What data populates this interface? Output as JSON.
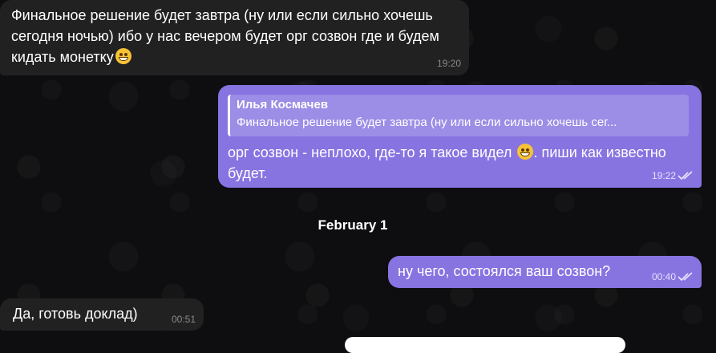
{
  "messages": [
    {
      "text": "Финальное решение будет завтра (ну или если сильно хочешь сегодня ночью) ибо у нас вечером будет орг созвон где и будем кидать монетку",
      "emoji": "zany-face-emoji",
      "time": "19:20",
      "direction": "incoming"
    },
    {
      "reply_name": "Илья Космачев",
      "reply_text": "Финальное решение будет завтра (ну или если сильно хочешь сег...",
      "text_before": "орг созвон - неплохо, где-то я такое видел",
      "emoji": "grinning-face-emoji",
      "text_after": ". пиши как известно будет.",
      "time": "19:22",
      "direction": "outgoing",
      "status": "read"
    },
    {
      "text": "ну чего, состоялся ваш созвон?",
      "time": "00:40",
      "direction": "outgoing",
      "status": "read"
    },
    {
      "text": "Да, готовь доклад)",
      "time": "00:51",
      "direction": "incoming"
    }
  ],
  "date_separator": "February 1",
  "colors": {
    "background": "#0e0e10",
    "incoming_bubble": "#212121",
    "outgoing_bubble": "#8774e1"
  }
}
